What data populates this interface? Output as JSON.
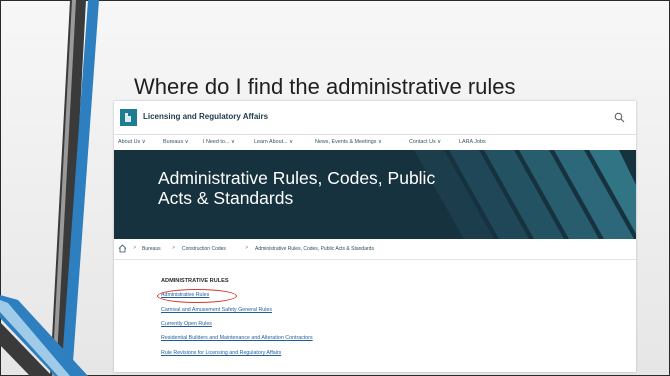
{
  "slide": {
    "title": "Where do I find the administrative rules"
  },
  "site": {
    "name": "Licensing and Regulatory Affairs",
    "nav": [
      "About Us  ∨",
      "Bureaus  ∨",
      "I Need to...  ∨",
      "Learn About...  ∨",
      "News, Events & Meetings  ∨",
      "Contact Us  ∨",
      "LARA Jobs"
    ],
    "hero_title": "Administrative Rules, Codes, Public Acts & Standards",
    "breadcrumb": [
      "Bureaus",
      "Construction Codes",
      "Administrative Rules, Codes, Public Acts & Standards"
    ],
    "breadcrumb_separator": ">",
    "section_heading": "ADMINISTRATIVE RULES",
    "links": [
      "Administrative Rules",
      "Carnival and Amusement Safety General Rules",
      "Currently Open Rules",
      "Residential Builders and Maintenance and Alteration Contractors",
      "Rule Revisions for Licensing and Regulatory Affairs"
    ]
  },
  "colors": {
    "brand": "#1e7c93",
    "hero_bg": "#16323f",
    "link": "#1f5e9c",
    "annotation": "#d43a2f",
    "decor_dark": "#3a3a3a",
    "decor_blue": "#2e7fbf"
  },
  "icons": [
    "logo-icon",
    "search-icon",
    "home-icon"
  ]
}
